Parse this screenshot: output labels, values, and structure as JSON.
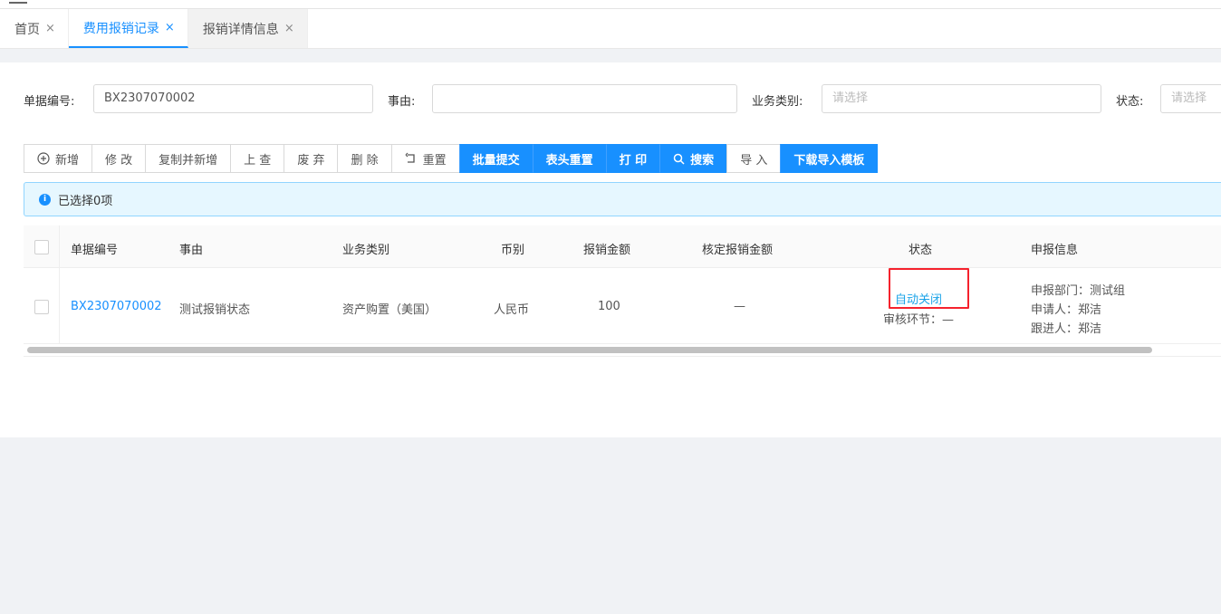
{
  "tabs": [
    {
      "label": "首页",
      "close": "×"
    },
    {
      "label": "费用报销记录",
      "close": "×"
    },
    {
      "label": "报销详情信息",
      "close": "×"
    }
  ],
  "filters": {
    "doc_no_label": "单据编号:",
    "doc_no_value": "BX2307070002",
    "reason_label": "事由:",
    "reason_value": "",
    "category_label": "业务类别:",
    "category_placeholder": "请选择",
    "status_label": "状态:",
    "status_placeholder": "请选择"
  },
  "toolbar": {
    "add": "新增",
    "edit": "修 改",
    "copy_add": "复制并新增",
    "lookup": "上 查",
    "discard": "废 弃",
    "delete": "删 除",
    "reset": "重置",
    "batch_submit": "批量提交",
    "header_reset": "表头重置",
    "print": "打 印",
    "search": "搜索",
    "import": "导 入",
    "download_template": "下载导入模板"
  },
  "alert": {
    "text": "已选择0项"
  },
  "table": {
    "headers": [
      "单据编号",
      "事由",
      "业务类别",
      "币别",
      "报销金额",
      "核定报销金额",
      "状态",
      "申报信息"
    ],
    "rows": [
      {
        "doc_no": "BX2307070002",
        "reason": "测试报销状态",
        "category": "资产购置（美国）",
        "currency": "人民币",
        "amount": "100",
        "approved_amount": "—",
        "status": "自动关闭",
        "review_stage": "审核环节：—",
        "dept": "申报部门：测试组",
        "applicant": "申请人：郑洁",
        "follower": "跟进人：郑洁"
      }
    ]
  },
  "colors": {
    "primary": "#1890ff",
    "highlight": "#f5222d"
  }
}
